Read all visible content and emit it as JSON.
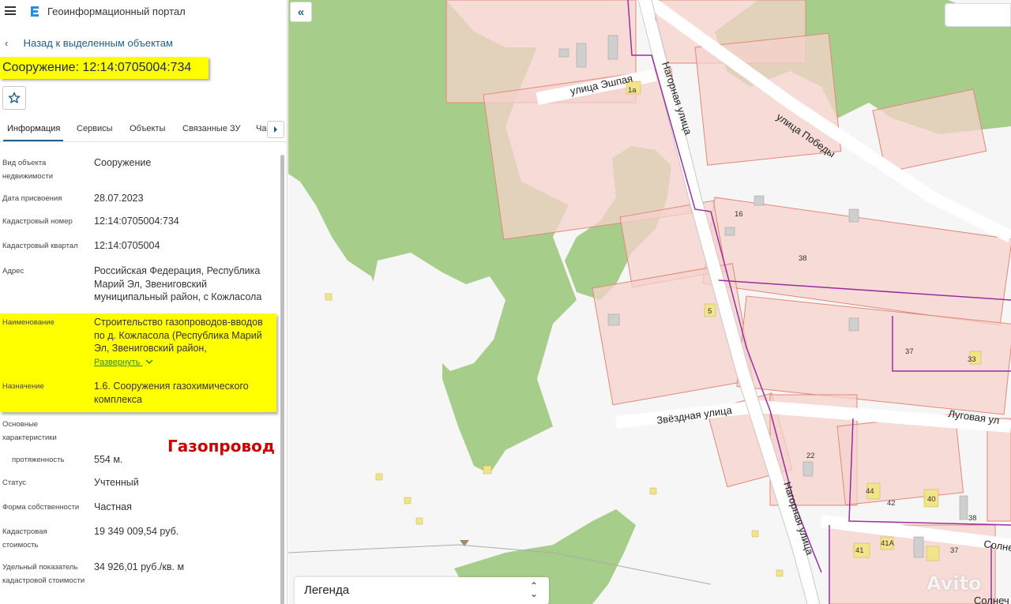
{
  "app": {
    "title": "Геоинформационный портал"
  },
  "nav": {
    "back_label": "Назад к выделенным объектам"
  },
  "object": {
    "title": "Сооружение: 12:14:0705004:734"
  },
  "tabs": [
    {
      "label": "Информация"
    },
    {
      "label": "Сервисы"
    },
    {
      "label": "Объекты"
    },
    {
      "label": "Связанные ЗУ"
    },
    {
      "label": "Ча"
    }
  ],
  "fields": {
    "type": {
      "label": "Вид объекта недвижимости",
      "value": "Сооружение"
    },
    "date": {
      "label": "Дата присвоения",
      "value": "28.07.2023"
    },
    "cadnum": {
      "label": "Кадастровый номер",
      "value": "12:14:0705004:734"
    },
    "quarter": {
      "label": "Кадастровый квартал",
      "value": "12:14:0705004"
    },
    "address": {
      "label": "Адрес",
      "value": "Российская Федерация, Республика Марий Эл, Звениговский муниципальный район, с Кожласола"
    },
    "name": {
      "label": "Наименование",
      "value": "Строительство газопроводов-вводов по д. Кожласола (Республика Марий Эл, Звениговский район,",
      "expand": "Развернуть"
    },
    "purpose": {
      "label": "Назначение",
      "value": "1.6. Сооружения газохимического комплекса"
    },
    "main_chars": {
      "label": "Основные характеристики"
    },
    "length": {
      "label": "протяженность",
      "value": "554 м."
    },
    "status": {
      "label": "Статус",
      "value": "Учтенный"
    },
    "ownership": {
      "label": "Форма собственности",
      "value": "Частная"
    },
    "cost": {
      "label": "Кадастровая стоимость",
      "value": "19 349 009,54 руб."
    },
    "unit_cost": {
      "label": "Удельный показатель кадастровой стоимости",
      "value": "34 926,01 руб./кв. м"
    }
  },
  "annotation": {
    "gas_label": "Газопровод"
  },
  "map": {
    "streets": {
      "street1": "улица Эшпая",
      "street2": "Нагорная улица",
      "street3": "улица Победы",
      "street4": "Звёздная улица",
      "street5": "Луговая ул",
      "street6": "Нагорная улица",
      "street7": "Солне",
      "street8": "Солнеч"
    },
    "plots": {
      "p1a": "1а",
      "p16": "16",
      "p38": "38",
      "p5": "5",
      "p37": "37",
      "p33": "33",
      "p22": "22",
      "p44": "44",
      "p42": "42",
      "p40": "40",
      "p38b": "38",
      "p41": "41",
      "p41a": "41А",
      "p37b": "37"
    },
    "legend_label": "Легенда",
    "watermark": "Avito"
  },
  "colors": {
    "forest": "#a6cd89",
    "plot_fill": "#f6d2cc",
    "plot_border": "#e08a78",
    "gas_line": "#9b2fa0",
    "highlight": "#ffff00"
  }
}
